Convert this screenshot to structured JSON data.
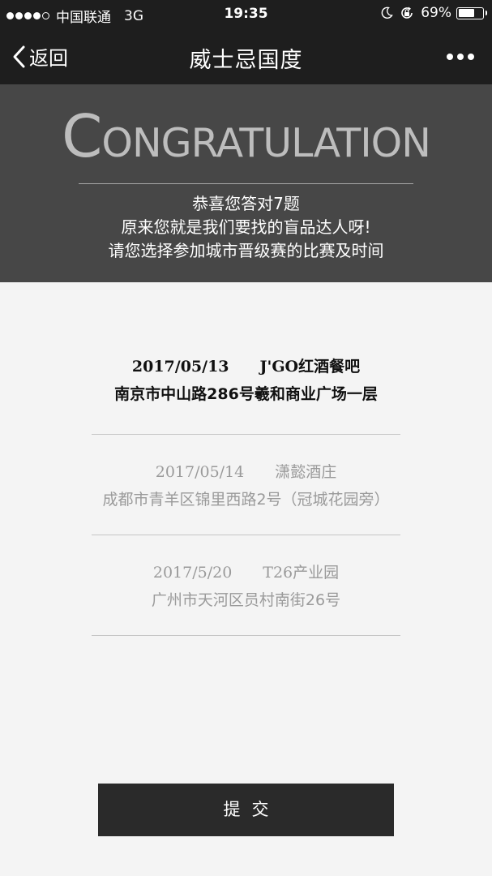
{
  "status_bar": {
    "carrier": "中国联通",
    "network": "3G",
    "time": "19:35",
    "battery": "69%",
    "battery_level": 0.69,
    "signal_strength": 4
  },
  "nav": {
    "back_label": "返回",
    "title": "威士忌国度"
  },
  "banner": {
    "title_cap": "C",
    "title_rest": "ONGRATULATION",
    "line1": "恭喜您答对7题",
    "line2": "原来您就是我们要找的盲品达人呀!",
    "line3": "请您选择参加城市晋级赛的比赛及时间"
  },
  "options": [
    {
      "date": "2017/05/13",
      "venue": "J'GO红酒餐吧",
      "address": "南京市中山路286号羲和商业广场一层",
      "selected": true
    },
    {
      "date": "2017/05/14",
      "venue": "潇懿酒庄",
      "address": "成都市青羊区锦里西路2号（冠城花园旁）",
      "selected": false
    },
    {
      "date": "2017/5/20",
      "venue": "T26产业园",
      "address": "广州市天河区员村南街26号",
      "selected": false
    }
  ],
  "submit_label": "提交",
  "colors": {
    "top_bar": "#1e1e1e",
    "banner": "#474747",
    "page_background": "#f4f4f4",
    "button": "#2a2a2a",
    "selected_text": "#111111",
    "unselected_text": "#9a9a9a"
  }
}
